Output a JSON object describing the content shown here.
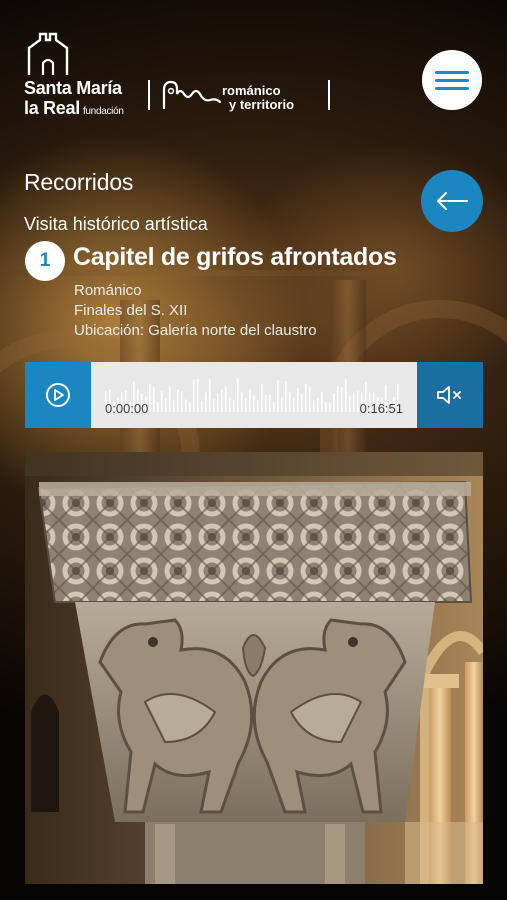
{
  "header": {
    "brand_line1": "Santa María",
    "brand_line2": "la Real",
    "brand_suffix": "fundación",
    "partner_line1": "románico",
    "partner_line2": "y territorio",
    "icons": [
      "menu-icon",
      "tower-logo-icon",
      "territory-logo-icon"
    ]
  },
  "page": {
    "section_title": "Recorridos",
    "tour_name": "Visita histórico artística"
  },
  "stop": {
    "number": "1",
    "title": "Capitel de grifos afrontados",
    "style": "Románico",
    "date": "Finales del S. XII",
    "location": "Ubicación: Galería norte del claustro"
  },
  "player": {
    "current_time": "0:00:00",
    "total_time": "0:16:51",
    "progress": 0,
    "muted": true,
    "icons": [
      "play-icon",
      "mute-icon"
    ]
  },
  "colors": {
    "accent": "#1b87c0",
    "accent_dark": "#1b6fa0",
    "player_track": "#e8e8e8"
  }
}
